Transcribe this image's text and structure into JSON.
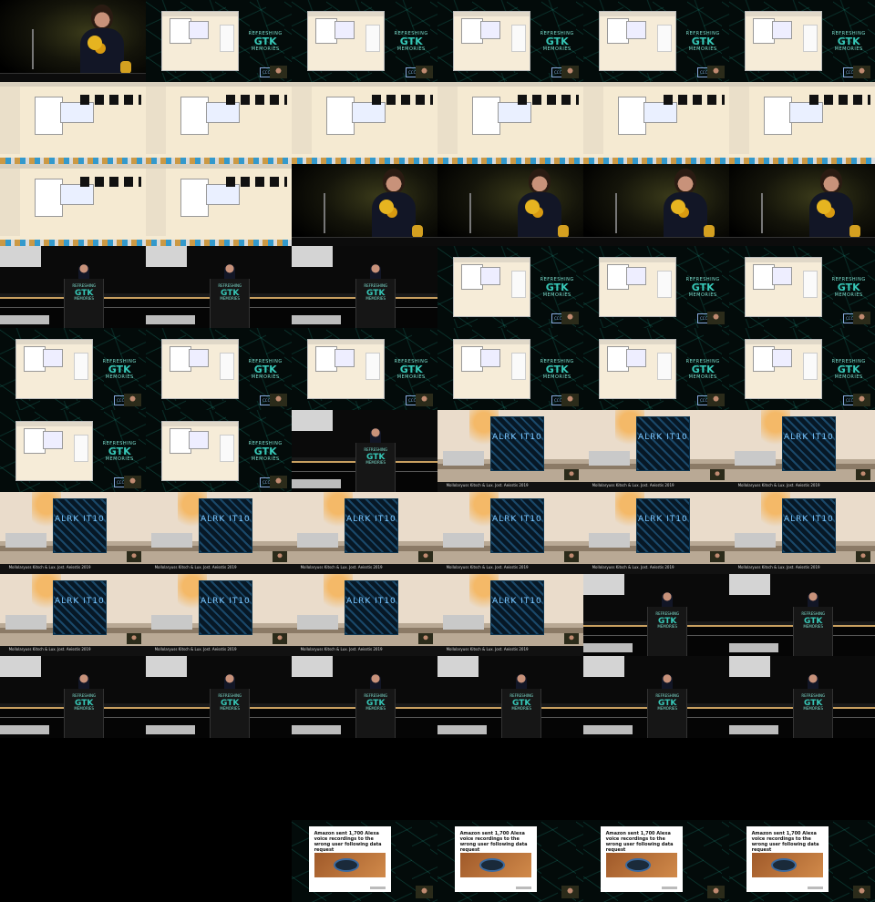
{
  "brand": {
    "line1": "REFRESHING",
    "line2": "GTK",
    "line3": "MEMORIES",
    "accent": "#36c6b6",
    "badge": "CCC"
  },
  "slide_caption": "Mollolaryuss Kitsch & Lux. Jost. Aeisstis 2019",
  "screen_art_text": "ALRK IT10",
  "news_headline": "Amazon sent 1,700 Alexa voice recordings to the wrong user following data request",
  "tiles": [
    "stage",
    "screen",
    "screen",
    "screen",
    "screen",
    "screen",
    "desktop",
    "desktop",
    "desktop",
    "desktop",
    "desktop",
    "desktop",
    "desktop",
    "desktop",
    "stage",
    "stage",
    "stage",
    "stage",
    "hall",
    "hall",
    "hall",
    "screen",
    "screen",
    "screen",
    "screen",
    "screen",
    "screen",
    "screen",
    "screen",
    "screen",
    "screen",
    "screen",
    "hall",
    "photo",
    "photo",
    "photo",
    "photo",
    "photo",
    "photo",
    "photo",
    "photo",
    "photo",
    "photo",
    "photo",
    "photo",
    "photo",
    "hall",
    "hall",
    "hall",
    "hall",
    "hall",
    "hall",
    "hall",
    "hall",
    "podium",
    "podium",
    "podium",
    "podium",
    "podium",
    "podium",
    "podium",
    "podium",
    "news",
    "news",
    "news",
    "news"
  ]
}
